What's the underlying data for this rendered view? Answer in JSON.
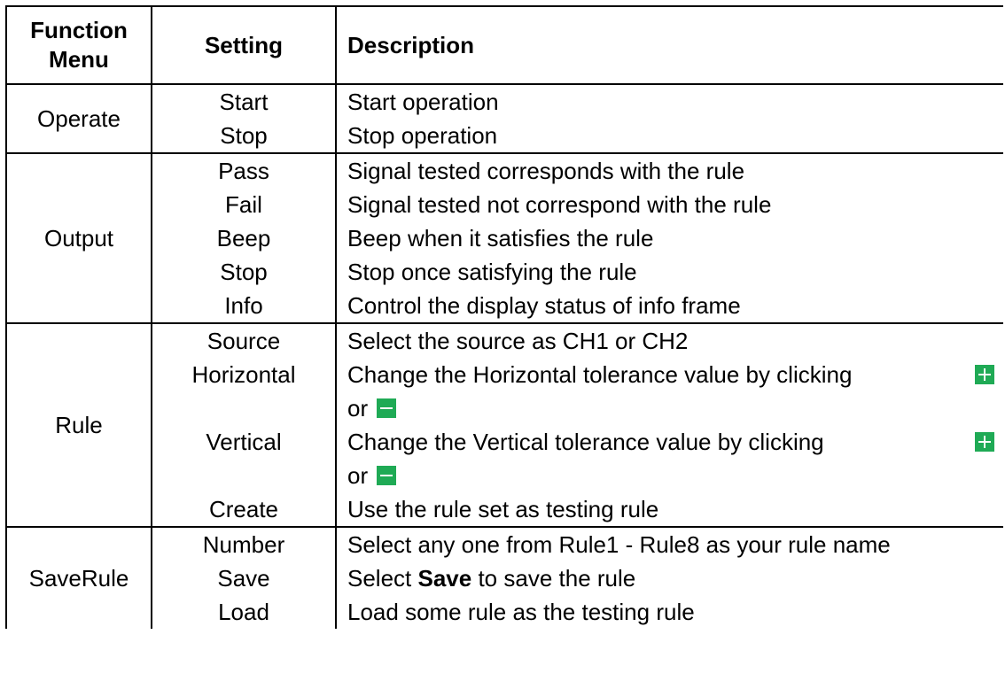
{
  "header": {
    "col1_line1": "Function",
    "col1_line2": "Menu",
    "col2": "Setting",
    "col3": "Description"
  },
  "groups": [
    {
      "function": "Operate",
      "rows": [
        {
          "setting": "Start",
          "description": "Start operation"
        },
        {
          "setting": "Stop",
          "description": "Stop operation"
        }
      ]
    },
    {
      "function": "Output",
      "rows": [
        {
          "setting": "Pass",
          "description": "Signal tested corresponds with the rule"
        },
        {
          "setting": "Fail",
          "description": "Signal tested not correspond with the rule"
        },
        {
          "setting": "Beep",
          "description": "Beep when it satisfies the rule"
        },
        {
          "setting": "Stop",
          "description": "Stop once satisfying the rule"
        },
        {
          "setting": "Info",
          "description": "Control the display status of info frame"
        }
      ]
    },
    {
      "function": "Rule",
      "rows": [
        {
          "setting": "Source",
          "description": "Select the source as CH1 or CH2"
        },
        {
          "setting": "Horizontal",
          "description_line1": "Change the Horizontal tolerance value by clicking",
          "description_line2": "or"
        },
        {
          "setting": "Vertical",
          "description_line1": "Change the Vertical tolerance value by clicking",
          "description_line2": "or"
        },
        {
          "setting": "Create",
          "description": "Use the rule set as testing rule"
        }
      ]
    },
    {
      "function": "SaveRule",
      "rows": [
        {
          "setting": "Number",
          "description": "Select any one from Rule1 - Rule8 as your rule name"
        },
        {
          "setting": "Save",
          "description_pre": "Select ",
          "description_bold": "Save",
          "description_post": " to save the rule"
        },
        {
          "setting": "Load",
          "description": "Load some rule as the testing rule"
        }
      ]
    }
  ],
  "icons": {
    "plus": "plus-icon",
    "minus": "minus-icon",
    "color": "#1faa55"
  }
}
